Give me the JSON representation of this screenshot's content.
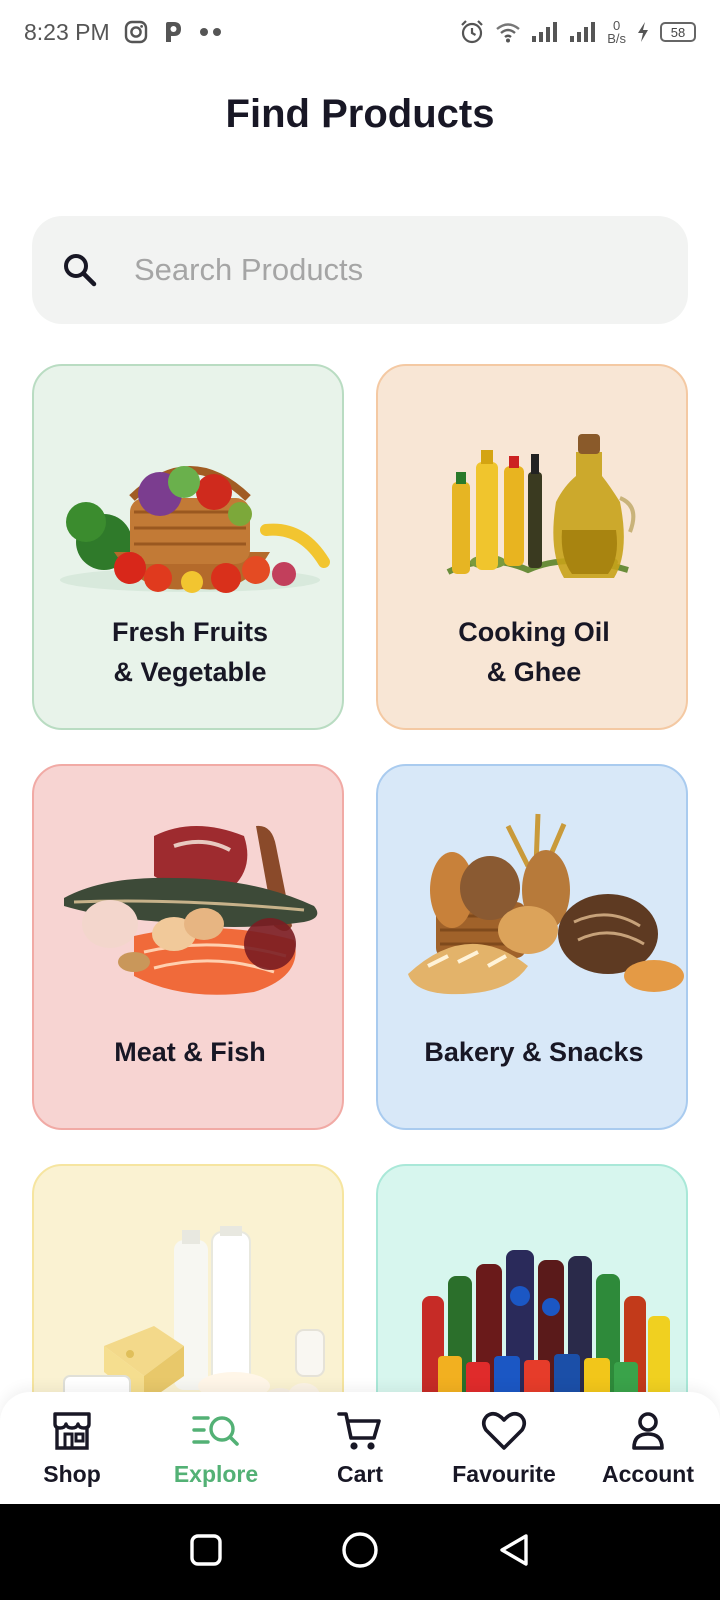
{
  "status_bar": {
    "time": "8:23 PM",
    "net_speed_value": "0",
    "net_speed_unit": "B/s",
    "battery": "58"
  },
  "page": {
    "title": "Find Products"
  },
  "search": {
    "placeholder": "Search Products",
    "value": ""
  },
  "categories": [
    {
      "line1": "Fresh Fruits",
      "line2": "& Vegetable",
      "bg": "#e8f3ea",
      "border": "#b9dcc2"
    },
    {
      "line1": "Cooking Oil",
      "line2": "& Ghee",
      "bg": "#f8e6d5",
      "border": "#f4c9a3"
    },
    {
      "line1": "Meat & Fish",
      "line2": "",
      "bg": "#f7d4d2",
      "border": "#f1aaa5"
    },
    {
      "line1": "Bakery & Snacks",
      "line2": "",
      "bg": "#d8e8f8",
      "border": "#a9cbef"
    },
    {
      "line1": "",
      "line2": "",
      "bg": "#faf2d2",
      "border": "#f6e5a0"
    },
    {
      "line1": "",
      "line2": "",
      "bg": "#d7f6ee",
      "border": "#a9e8d8"
    }
  ],
  "bottom_nav": {
    "items": [
      {
        "label": "Shop",
        "icon": "store-icon",
        "active": false
      },
      {
        "label": "Explore",
        "icon": "explore-icon",
        "active": true
      },
      {
        "label": "Cart",
        "icon": "cart-icon",
        "active": false
      },
      {
        "label": "Favourite",
        "icon": "heart-icon",
        "active": false
      },
      {
        "label": "Account",
        "icon": "person-icon",
        "active": false
      }
    ],
    "active_color": "#53b175"
  },
  "system_nav": {
    "buttons": [
      "recents-icon",
      "home-icon",
      "back-icon"
    ]
  }
}
